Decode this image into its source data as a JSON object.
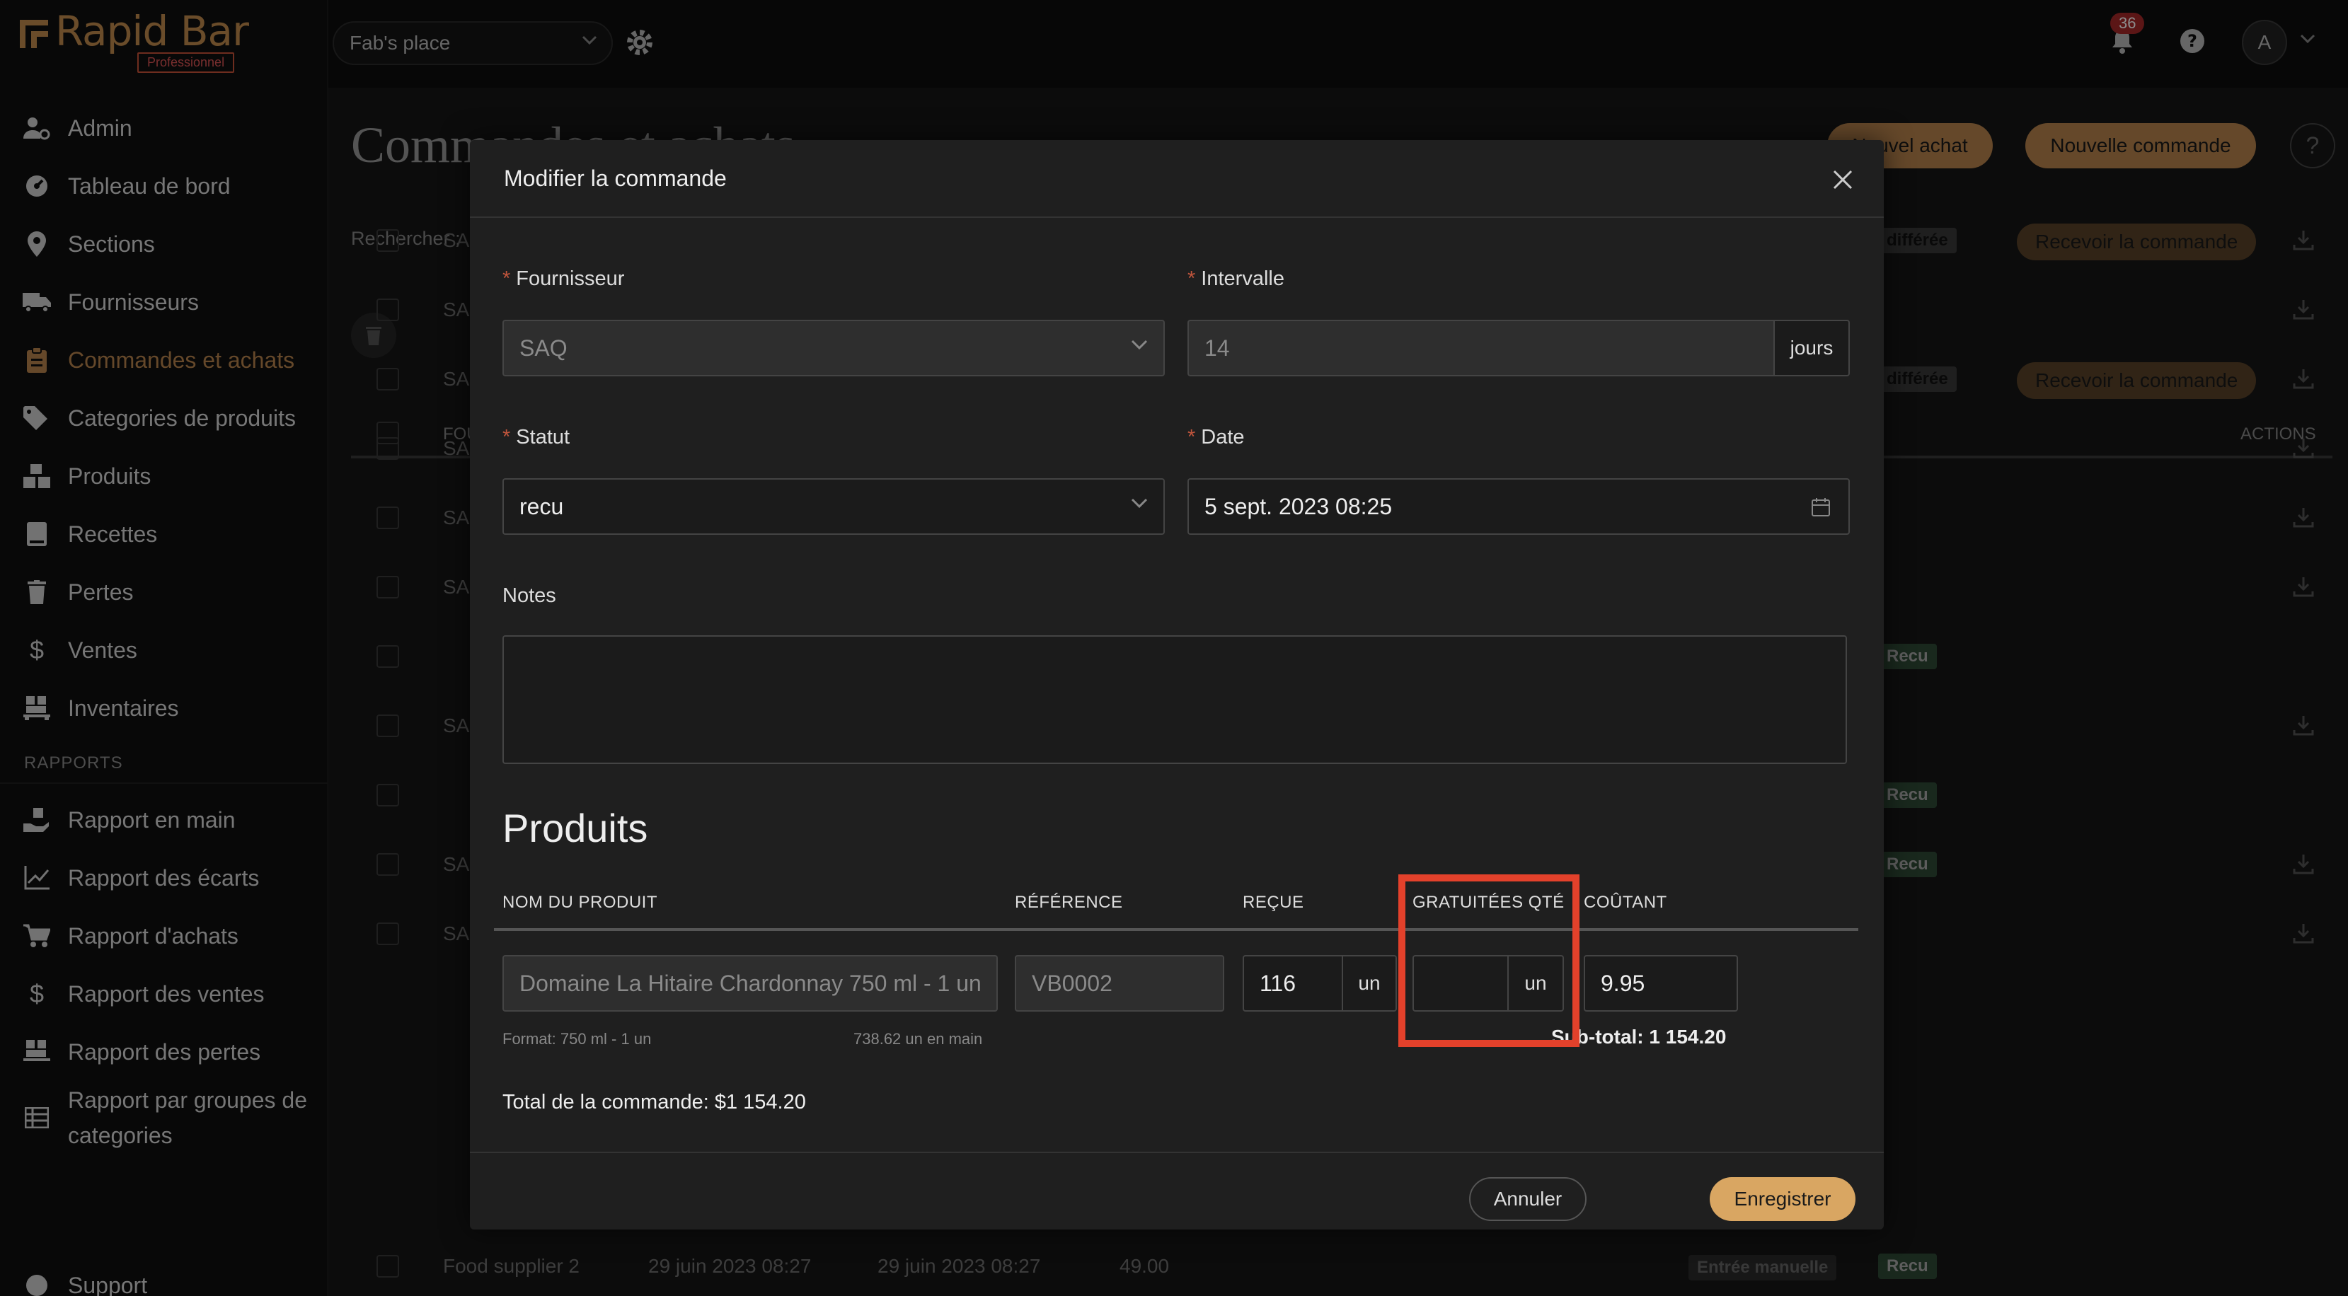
{
  "app": {
    "logo_text": "Rapid Bar",
    "logo_badge": "Professionnel"
  },
  "colors": {
    "accent": "#b9844d",
    "highlight": "#e3412b",
    "required": "#c0553c"
  },
  "topbar": {
    "place": "Fab's place",
    "notifications": "36",
    "avatar_initial": "A"
  },
  "sidebar": {
    "items": [
      {
        "label": "Admin",
        "icon": "user-cog-icon"
      },
      {
        "label": "Tableau de bord",
        "icon": "dashboard-icon"
      },
      {
        "label": "Sections",
        "icon": "location-pin-icon"
      },
      {
        "label": "Fournisseurs",
        "icon": "truck-icon"
      },
      {
        "label": "Commandes et achats",
        "icon": "clipboard-icon",
        "active": true
      },
      {
        "label": "Categories de produits",
        "icon": "tags-icon"
      },
      {
        "label": "Produits",
        "icon": "boxes-icon"
      },
      {
        "label": "Recettes",
        "icon": "book-icon"
      },
      {
        "label": "Pertes",
        "icon": "trash-icon"
      },
      {
        "label": "Ventes",
        "icon": "dollar-icon"
      },
      {
        "label": "Inventaires",
        "icon": "pallet-icon"
      }
    ],
    "section_label": "RAPPORTS",
    "reports": [
      {
        "label": "Rapport en main",
        "icon": "hand-box-icon"
      },
      {
        "label": "Rapport des écarts",
        "icon": "chart-line-icon"
      },
      {
        "label": "Rapport d'achats",
        "icon": "cart-icon"
      },
      {
        "label": "Rapport des ventes",
        "icon": "dollar-icon"
      },
      {
        "label": "Rapport des pertes",
        "icon": "pallet-icon"
      },
      {
        "label": "Rapport par groupes de categories",
        "icon": "table-icon"
      }
    ],
    "support": "Support"
  },
  "page": {
    "title": "Commandes et achats",
    "btn_new_purchase": "Nouvel achat",
    "btn_new_order": "Nouvelle commande",
    "search_label": "Rechercher :",
    "col_supplier": "FOU",
    "col_actions": "ACTIONS",
    "rows": [
      {
        "supplier": "SAC",
        "tag": "différée",
        "action": "Recevoir la commande"
      },
      {
        "supplier": "SAC"
      },
      {
        "supplier": "SAC",
        "tag": "différée",
        "action": "Recevoir la commande"
      },
      {
        "supplier": "SAC"
      },
      {
        "supplier": "SAC"
      },
      {
        "supplier": "SAC"
      },
      {
        "supplier": "",
        "tag": "Recu"
      },
      {
        "supplier": "SAC"
      },
      {
        "supplier": "",
        "tag": "Recu"
      },
      {
        "supplier": "SAC",
        "tag": "Recu"
      },
      {
        "supplier": "SAC"
      }
    ],
    "last_row": {
      "supplier": "Food supplier 2",
      "date1": "29 juin 2023 08:27",
      "date2": "29 juin 2023 08:27",
      "amount": "49.00",
      "tag1": "Entrée manuelle",
      "tag2": "Recu"
    }
  },
  "modal": {
    "title": "Modifier la commande",
    "supplier_label": "Fournisseur",
    "supplier_value": "SAQ",
    "interval_label": "Intervalle",
    "interval_value": "14",
    "interval_unit": "jours",
    "status_label": "Statut",
    "status_value": "recu",
    "date_label": "Date",
    "date_value": "5 sept. 2023 08:25",
    "notes_label": "Notes",
    "notes_value": "",
    "products_heading": "Produits",
    "columns": {
      "name": "NOM DU PRODUIT",
      "reference": "RÉFÉRENCE",
      "received": "REÇUE",
      "free_qty": "GRATUITÉES QTÉ",
      "cost": "COÛTANT"
    },
    "product": {
      "name": "Domaine La Hitaire Chardonnay 750 ml - 1 un",
      "reference": "VB0002",
      "received": "116",
      "received_unit": "un",
      "free_qty": "",
      "free_unit": "un",
      "cost": "9.95",
      "format_hint": "Format: 750 ml - 1 un",
      "on_hand_hint": "738.62 un en main",
      "subtotal": "Sub-total: 1 154.20"
    },
    "order_total": "Total de la commande: $1 154.20",
    "btn_cancel": "Annuler",
    "btn_save": "Enregistrer"
  }
}
